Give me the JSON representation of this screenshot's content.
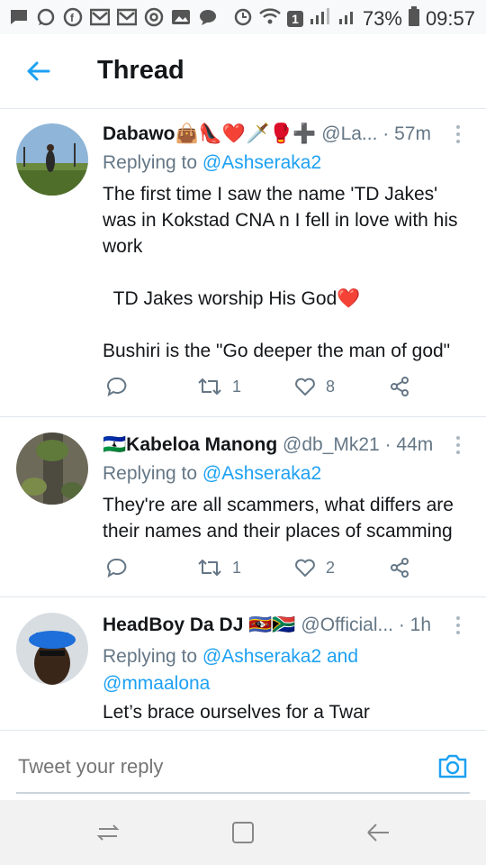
{
  "status": {
    "battery": "73%",
    "time": "09:57",
    "notif_count": "1"
  },
  "header": {
    "title": "Thread"
  },
  "tweets": [
    {
      "name": "Dabawo",
      "emojis": "👜👠❤️🗡️🥊➕",
      "handle": "@La...",
      "time": "· 57m",
      "replying_prefix": "Replying to ",
      "replying_to": "@Ashseraka2",
      "body": "The first time I saw the name 'TD Jakes' was in Kokstad CNA n I fell in love with his work\n\n  TD Jakes worship His God❤️\n\nBushiri is the \"Go deeper the man of god\"",
      "retweets": "1",
      "likes": "8"
    },
    {
      "name": "Kabeloa Manong",
      "flag": "🇱🇸",
      "handle": "@db_Mk21",
      "time": "· 44m",
      "replying_prefix": "Replying to ",
      "replying_to": "@Ashseraka2",
      "body": "They're are all scammers, what differs are their names and their places of scamming",
      "retweets": "1",
      "likes": "2"
    },
    {
      "name": "HeadBoy Da DJ",
      "flags": "🇸🇿🇿🇦",
      "handle": "@Official...",
      "time": "· 1h",
      "replying_prefix": "Replying to ",
      "replying_to": "@Ashseraka2 and",
      "replying_to_2": "@mmaalona",
      "body": "Let’s brace ourselves for a Twar"
    }
  ],
  "reply_bar": {
    "placeholder": "Tweet your reply"
  },
  "colors": {
    "accent": "#1da1f2",
    "muted": "#657786",
    "text": "#14171a",
    "divider": "#e1e8ed"
  }
}
